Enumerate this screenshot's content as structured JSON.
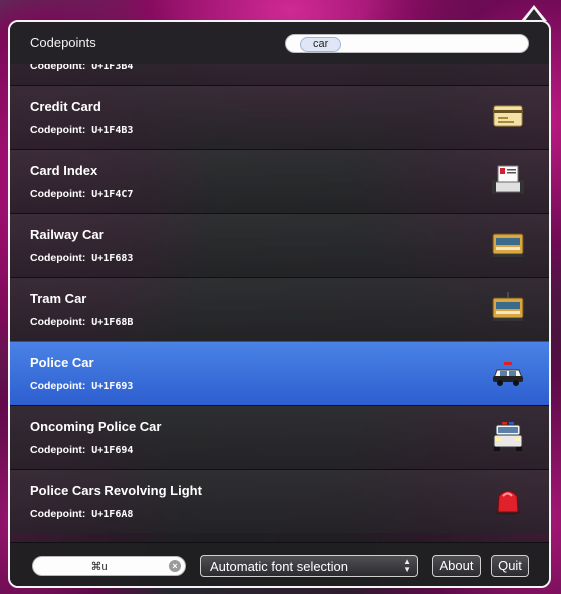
{
  "header": {
    "title": "Codepoints",
    "search_token": "car"
  },
  "list": {
    "codepoint_label": "Codepoint:",
    "partial_row": {
      "codepoint": "U+1F3B4",
      "icon": "flower-playing-cards-icon"
    },
    "rows": [
      {
        "name": "Credit Card",
        "codepoint": "U+1F4B3",
        "icon": "credit-card-icon",
        "selected": false
      },
      {
        "name": "Card Index",
        "codepoint": "U+1F4C7",
        "icon": "card-index-icon",
        "selected": false
      },
      {
        "name": "Railway Car",
        "codepoint": "U+1F683",
        "icon": "railway-car-icon",
        "selected": false
      },
      {
        "name": "Tram Car",
        "codepoint": "U+1F68B",
        "icon": "tram-car-icon",
        "selected": false
      },
      {
        "name": "Police Car",
        "codepoint": "U+1F693",
        "icon": "police-car-icon",
        "selected": true
      },
      {
        "name": "Oncoming Police Car",
        "codepoint": "U+1F694",
        "icon": "oncoming-police-car-icon",
        "selected": false
      },
      {
        "name": "Police Cars Revolving Light",
        "codepoint": "U+1F6A8",
        "icon": "police-light-icon",
        "selected": false
      }
    ]
  },
  "footer": {
    "shortcut_value": "⌘u",
    "font_selection": "Automatic font selection",
    "about_label": "About",
    "quit_label": "Quit"
  },
  "colors": {
    "selection": "#3a6fdc",
    "border": "#f4f4f4"
  }
}
